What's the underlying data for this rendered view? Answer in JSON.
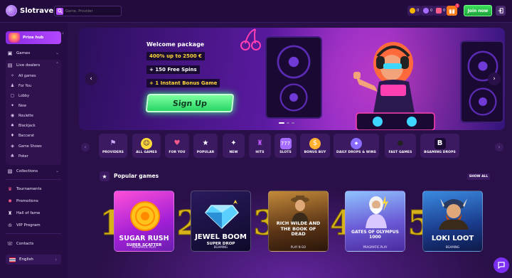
{
  "header": {
    "logo_text": "Slotrave",
    "search_placeholder": "Game, Provider",
    "wallets": [
      {
        "icon": "coin-icon",
        "value": "0",
        "color": "#f5b400"
      },
      {
        "icon": "gem-icon",
        "value": "0",
        "color": "#a56bff"
      },
      {
        "icon": "bonus-icon",
        "value": "0",
        "color": "#ff5a8a"
      }
    ],
    "gift_badge": "1",
    "join_label": "Join now"
  },
  "sidebar": {
    "prize_hub": "Prize hub",
    "games": "Games",
    "live_dealers": "Live dealers",
    "live_items": [
      "All games",
      "For You",
      "Lobby",
      "New",
      "Roulette",
      "Blackjack",
      "Baccarat",
      "Game Shows",
      "Poker"
    ],
    "collections": "Collections",
    "tournaments": "Tournaments",
    "promotions": "Promotions",
    "hall_of_fame": "Hall of fame",
    "vip": "VIP Program",
    "contacts": "Contacts",
    "language": "English"
  },
  "hero": {
    "title": "Welcome package",
    "line1": "400% up to 2500 €",
    "line2": "+ 150 Free Spins",
    "line3": "+ 1 Instant Bonus Game",
    "cta": "Sign Up"
  },
  "categories": [
    {
      "label": "PROVIDERS",
      "icon": "flag-icon",
      "color": "#c9a7ff"
    },
    {
      "label": "ALL GAMES",
      "icon": "smiley-icon",
      "color": "#ffd83a"
    },
    {
      "label": "FOR YOU",
      "icon": "candle-icon",
      "color": "#ff5a8a"
    },
    {
      "label": "POPULAR",
      "icon": "star-icon",
      "color": "#ffffff"
    },
    {
      "label": "NEW",
      "icon": "sparkle-icon",
      "color": "#ffffff"
    },
    {
      "label": "HITS",
      "icon": "joystick-icon",
      "color": "#c35bff"
    },
    {
      "label": "SLOTS",
      "icon": "slot-icon",
      "color": "#a56bff"
    },
    {
      "label": "BONUS BUY",
      "icon": "coin-icon",
      "color": "#ffb02e"
    },
    {
      "label": "DAILY DROPS & WINS",
      "icon": "drops-icon",
      "color": "#8a6cff"
    },
    {
      "label": "FAST GAMES",
      "icon": "bomb-icon",
      "color": "#222222"
    },
    {
      "label": "BGAMING DROPS",
      "icon": "bgaming-icon",
      "color": "#1a0a33"
    }
  ],
  "popular": {
    "title": "Popular games",
    "show_all": "SHOW ALL",
    "games": [
      {
        "rank": "1",
        "title": "SUGAR RUSH",
        "subtitle": "SUPER SCATTER",
        "provider": "PRAGMATIC PLAY"
      },
      {
        "rank": "2",
        "title": "JEWEL BOOM",
        "subtitle": "SUPER DROP",
        "provider": "BGAMING"
      },
      {
        "rank": "3",
        "title": "RICH WILDE AND THE BOOK OF DEAD",
        "subtitle": "",
        "provider": "PLAY N GO"
      },
      {
        "rank": "4",
        "title": "GATES OF OLYMPUS 1000",
        "subtitle": "",
        "provider": "PRAGMATIC PLAY"
      },
      {
        "rank": "5",
        "title": "LOKI LOOT",
        "subtitle": "",
        "provider": "BGAMING"
      }
    ]
  }
}
